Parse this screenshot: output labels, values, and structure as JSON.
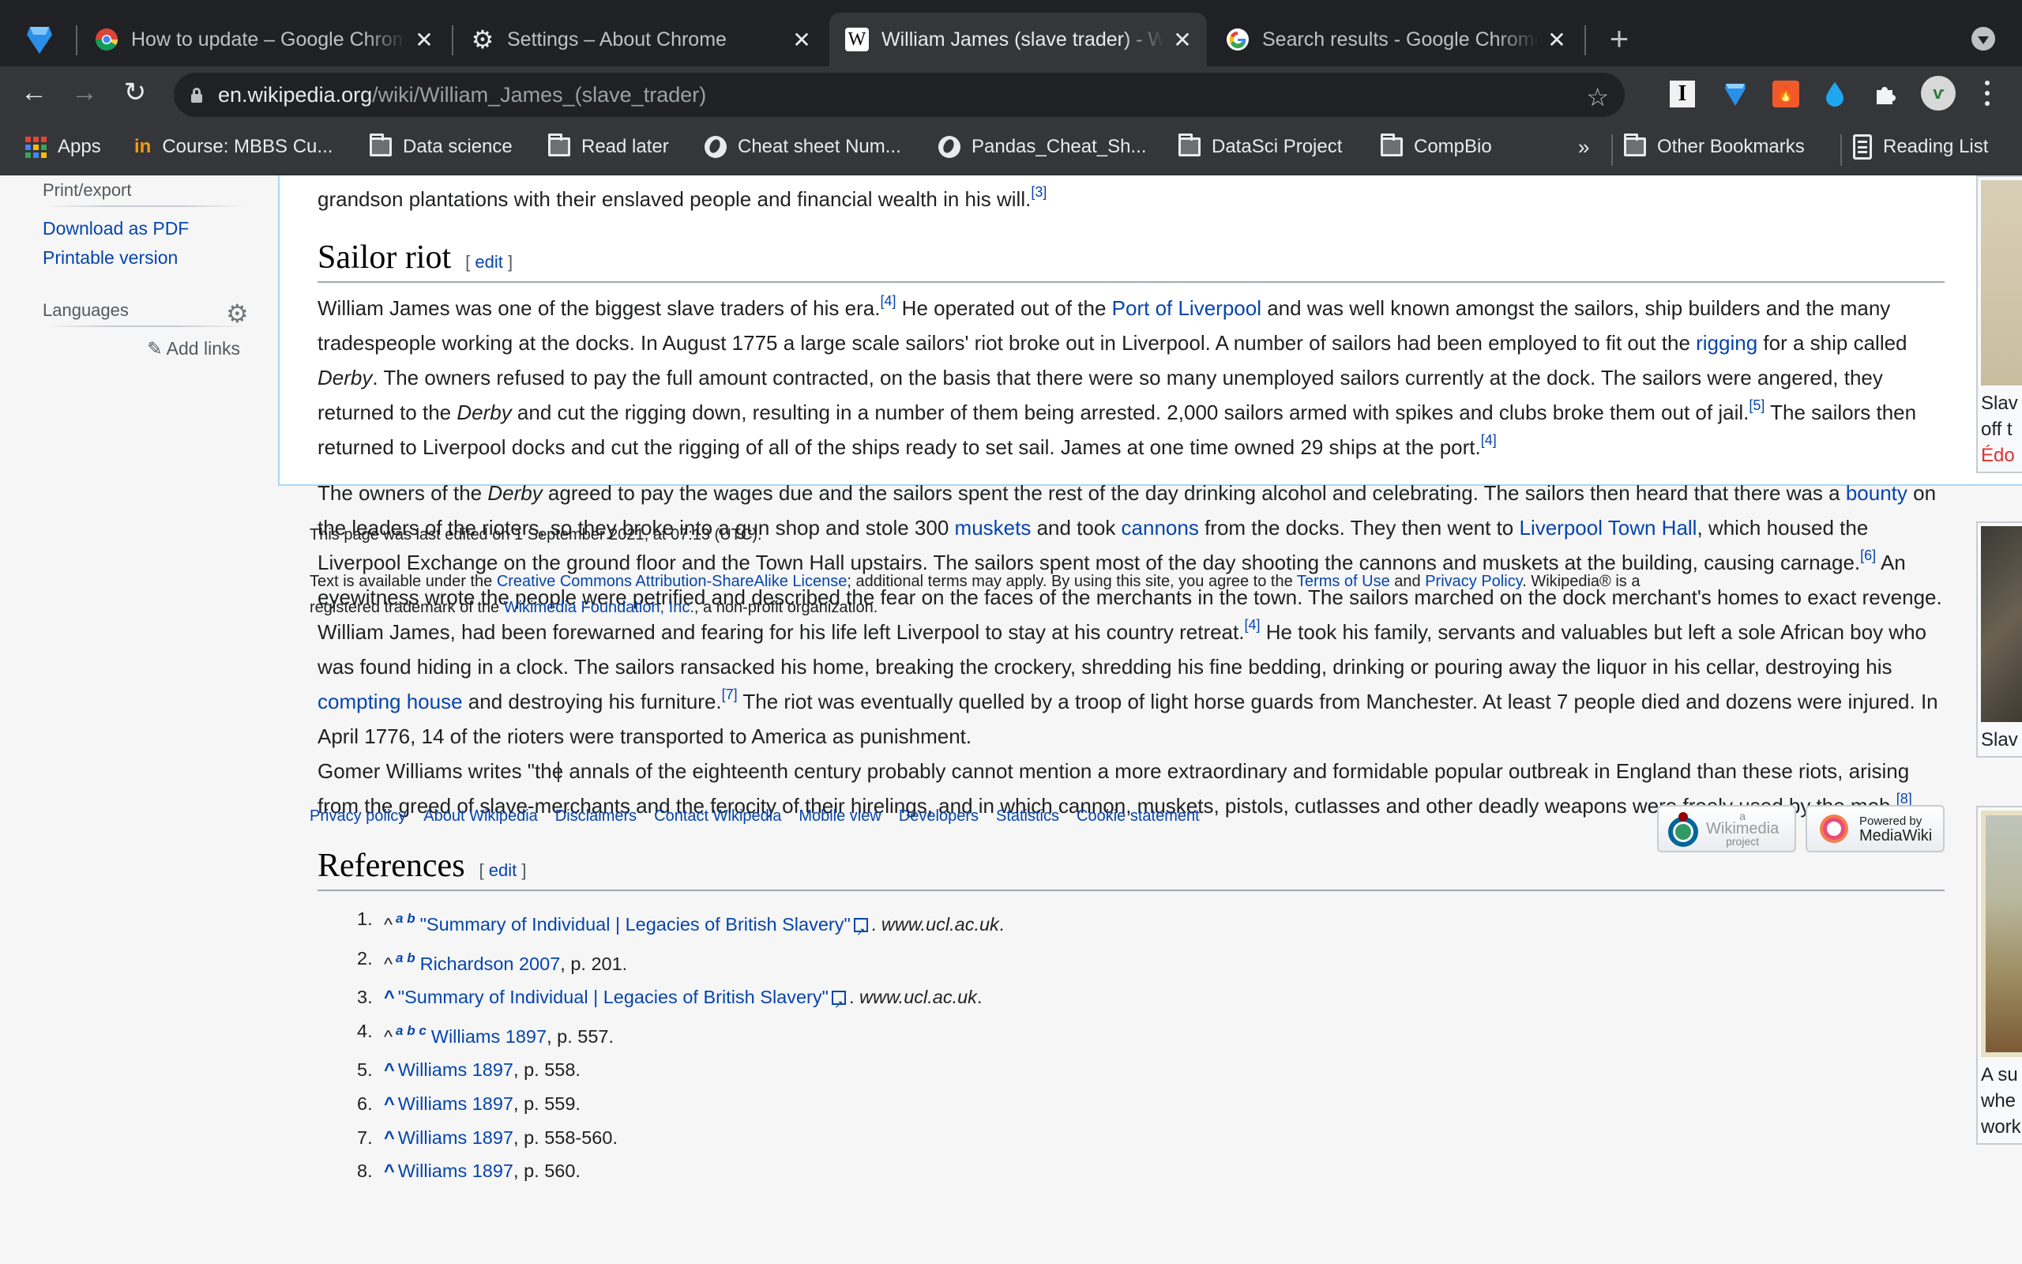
{
  "browser": {
    "tabs": [
      {
        "title": "How to update – Google Chrome Help",
        "favicon": "chrome-icon",
        "active": false
      },
      {
        "title": "Settings – About Chrome",
        "favicon": "gear-icon",
        "active": false
      },
      {
        "title": "William James (slave trader) - Wikipedia",
        "favicon": "wikipedia-w-icon",
        "active": true
      },
      {
        "title": "Search results - Google Chrome Help",
        "favicon": "google-g-icon",
        "active": false
      }
    ],
    "close_glyph": "✕",
    "new_tab_glyph": "+",
    "url_host": "en.wikipedia.org",
    "url_path": "/wiki/William_James_(slave_trader)",
    "bookmarks": [
      {
        "label": "Apps",
        "icon": "apps-grid-icon"
      },
      {
        "label": "Course: MBBS Cu...",
        "icon": "course-icon"
      },
      {
        "label": "Data science",
        "icon": "folder-icon"
      },
      {
        "label": "Read later",
        "icon": "folder-icon"
      },
      {
        "label": "Cheat sheet Num...",
        "icon": "globe-icon"
      },
      {
        "label": "Pandas_Cheat_Sh...",
        "icon": "globe-icon"
      },
      {
        "label": "DataSci Project",
        "icon": "folder-icon"
      },
      {
        "label": "CompBio",
        "icon": "folder-icon"
      }
    ],
    "bookmarks_overflow": "»",
    "other_bookmarks": "Other Bookmarks",
    "reading_list": "Reading List"
  },
  "sidebar": {
    "print_export_heading": "Print/export",
    "print_links": [
      "Download as PDF",
      "Printable version"
    ],
    "languages_heading": "Languages",
    "add_links": "Add links"
  },
  "article": {
    "intro_tail": "grandson plantations with their enslaved people and financial wealth in his will.",
    "intro_ref": "[3]",
    "edit_label": "edit",
    "sections": {
      "sailor_riot": {
        "title": "Sailor riot",
        "paragraph1": {
          "s1": "William James was one of the biggest slave traders of his era.",
          "r1": "[4]",
          "s2": " He operated out of the ",
          "link1": "Port of Liverpool",
          "s3": " and was well known amongst the sailors, ship builders and the many tradespeople working at the docks. In August 1775 a large scale sailors' riot broke out in Liverpool. A number of sailors had been employed to fit out the ",
          "link2": "rigging",
          "s4": " for a ship called ",
          "i1": "Derby",
          "s5": ". The owners refused to pay the full amount contracted, on the basis that there were so many unemployed sailors currently at the dock. The sailors were angered, they returned to the ",
          "i2": "Derby",
          "s6": " and cut the rigging down, resulting in a number of them being arrested. 2,000 sailors armed with spikes and clubs broke them out of jail.",
          "r2": "[5]",
          "s7": " The sailors then returned to Liverpool docks and cut the rigging of all of the ships ready to set sail. James at one time owned 29 ships at the port.",
          "r3": "[4]"
        },
        "paragraph2": {
          "s1": "The owners of the ",
          "i1": "Derby",
          "s2": " agreed to pay the wages due and the sailors spent the rest of the day drinking alcohol and celebrating. The sailors then heard that there was a ",
          "link1": "bounty",
          "s3": " on the leaders of the rioters, so they broke into a gun shop and stole 300 ",
          "link2": "muskets",
          "s4": " and took ",
          "link3": "cannons",
          "s5": " from the docks. They then went to ",
          "link4": "Liverpool Town Hall",
          "s6": ", which housed the Liverpool Exchange on the ground floor and the Town Hall upstairs. The sailors spent most of the day shooting the cannons and muskets at the building, causing carnage.",
          "r1": "[6]",
          "s7": " An eyewitness wrote the people were petrified and described the fear on the faces of the merchants in the town. The sailors marched on the dock merchant's homes to exact revenge. William James, had been forewarned and fearing for his life left Liverpool to stay at his country retreat.",
          "r2": "[4]",
          "s8": " He took his family, servants and valuables but left a sole African boy who was found hiding in a clock. The sailors ransacked his home, breaking the crockery, shredding his fine bedding, drinking or pouring away the liquor in his cellar, destroying his ",
          "link5": "compting house",
          "s9": " and destroying his furniture.",
          "r3": "[7]",
          "s10": " The riot was eventually quelled by a troop of light horse guards from Manchester. At least 7 people died and dozens were injured. In April 1776, 14 of the rioters were transported to America as punishment."
        },
        "paragraph3": {
          "s1": "Gomer Williams writes \"the annals of the eighteenth century probably cannot mention a more extraordinary and formidable popular outbreak in England than these riots, arising from the greed of slave-merchants and the ferocity of their hirelings, and in which cannon, muskets, pistols, cutlasses and other deadly weapons were freely used by the mob.",
          "r1": "[8]"
        }
      },
      "references": {
        "title": "References",
        "items": [
          {
            "num": "1.",
            "caret": "^",
            "letters": "a b",
            "link": "\"Summary of Individual | Legacies of British Slavery\"",
            "external": true,
            "suffix": ". ",
            "site": "www.ucl.ac.uk",
            "end": "."
          },
          {
            "num": "2.",
            "caret": "^",
            "letters": "a b",
            "link": "Richardson 2007",
            "external": false,
            "suffix": ", p. 201.",
            "site": "",
            "end": ""
          },
          {
            "num": "3.",
            "caret": "^",
            "letters": "",
            "link": "\"Summary of Individual | Legacies of British Slavery\"",
            "external": true,
            "suffix": ". ",
            "site": "www.ucl.ac.uk",
            "end": "."
          },
          {
            "num": "4.",
            "caret": "^",
            "letters": "a b c",
            "link": "Williams 1897",
            "external": false,
            "suffix": ", p. 557.",
            "site": "",
            "end": ""
          },
          {
            "num": "5.",
            "caret": "^",
            "letters": "",
            "link": "Williams 1897",
            "external": false,
            "suffix": ", p. 558.",
            "site": "",
            "end": ""
          },
          {
            "num": "6.",
            "caret": "^",
            "letters": "",
            "link": "Williams 1897",
            "external": false,
            "suffix": ", p. 559.",
            "site": "",
            "end": ""
          },
          {
            "num": "7.",
            "caret": "^",
            "letters": "",
            "link": "Williams 1897",
            "external": false,
            "suffix": ", p. 558-560.",
            "site": "",
            "end": ""
          },
          {
            "num": "8.",
            "caret": "^",
            "letters": "",
            "link": "Williams 1897",
            "external": false,
            "suffix": ", p. 560.",
            "site": "",
            "end": ""
          }
        ]
      }
    }
  },
  "footer": {
    "last_edited": "This page was last edited on 1 September 2021, at 07:13 (UTC).",
    "license_pre": "Text is available under the ",
    "license_link": "Creative Commons Attribution-ShareAlike License",
    "license_mid": "; additional terms may apply. By using this site, you agree to the ",
    "terms_link": "Terms of Use",
    "and": " and ",
    "privacy_link": "Privacy Policy",
    "license_post": ". Wikipedia® is a",
    "trademark_pre": "registered trademark of the ",
    "foundation_link": "Wikimedia Foundation, Inc.",
    "trademark_post": ", a non-profit organization.",
    "links": [
      "Privacy policy",
      "About Wikipedia",
      "Disclaimers",
      "Contact Wikipedia",
      "Mobile view",
      "Developers",
      "Statistics",
      "Cookie statement"
    ],
    "wikimedia_badge": {
      "top": "a",
      "name": "Wikimedia",
      "bottom": "project"
    },
    "mediawiki_badge": {
      "top": "Powered by",
      "name": "MediaWiki"
    }
  },
  "thumbnails": [
    {
      "caption_lines": [
        "Slav",
        "off t"
      ],
      "caption_red": "Édo"
    },
    {
      "caption_lines": [
        "Slav"
      ],
      "caption_red": ""
    },
    {
      "caption_lines": [
        "A su",
        "whe",
        "work"
      ],
      "caption_red": ""
    }
  ],
  "colors": {
    "link": "#0645ad",
    "text": "#202122",
    "chrome_dark": "#202124",
    "chrome_toolbar": "#35363a",
    "redlink": "#d33"
  }
}
